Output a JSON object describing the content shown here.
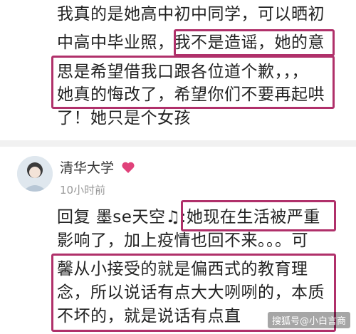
{
  "comment1": {
    "lines": [
      "我真的是她高中初中同学，可以晒初",
      "中高中毕业照，我不是造谣，她的意",
      "思是希望借我口跟各位道个歉，，，",
      "她真的悔改了，希望你们不要再起哄",
      "了！她只是个女孩"
    ]
  },
  "comment2": {
    "username": "清华大学",
    "time": "10小时前",
    "lines": [
      "回复 墨se天空♫:她现在生活被严重",
      "影响了，加上疫情也回不来。。。可",
      "馨从小接受的就是偏西式的教育理",
      "念，所以说话有点大大咧咧的，本质",
      "不坏的，就是说话有点直"
    ]
  },
  "watermark": "搜狐号@小白言商",
  "icons": {
    "avatar": "avatar-image",
    "heart": "heart-icon"
  },
  "colors": {
    "highlight_box": "#b0306a",
    "heart": "#e0427a"
  }
}
